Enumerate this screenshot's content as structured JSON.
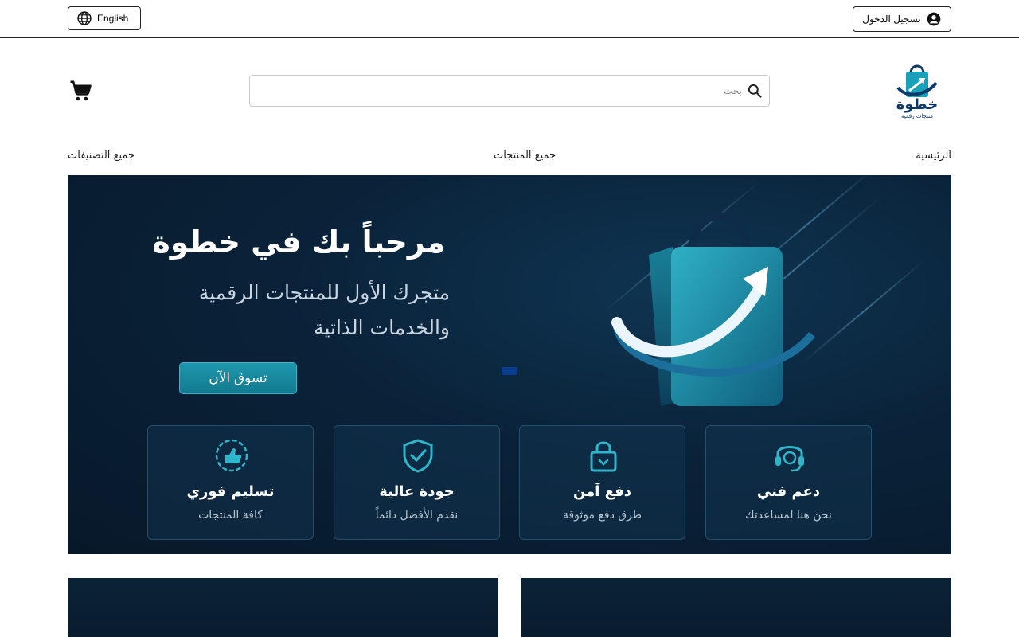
{
  "topbar": {
    "language_label": "English",
    "login_label": "تسجيل الدخول"
  },
  "header": {
    "logo_text": "خطوة",
    "logo_subtext": "منتجات رقمية",
    "search_placeholder": "بحث"
  },
  "nav": {
    "home": "الرئيسية",
    "all_products": "جميع المنتجات",
    "all_categories": "جميع التصنيفات"
  },
  "hero": {
    "title": "مرحباً بك في خطوة",
    "subtitle_line1": "متجرك الأول للمنتجات الرقمية",
    "subtitle_line2": "والخدمات الذاتية",
    "cta_label": "تسوق الآن",
    "features": [
      {
        "icon": "thumbs-up-badge-icon",
        "title": "تسليم فوري",
        "subtitle": "كافة المنتجات"
      },
      {
        "icon": "shield-check-icon",
        "title": "جودة عالية",
        "subtitle": "نقدم الأفضل دائماً"
      },
      {
        "icon": "lock-icon",
        "title": "دفع آمن",
        "subtitle": "طرق دفع موثوقة"
      },
      {
        "icon": "headset-icon",
        "title": "دعم فني",
        "subtitle": "نحن هنا لمساعدتك"
      }
    ]
  },
  "colors": {
    "accent": "#1e97ad",
    "brand_dark": "#0d3a6b",
    "hero_bg": "#0a2239"
  }
}
